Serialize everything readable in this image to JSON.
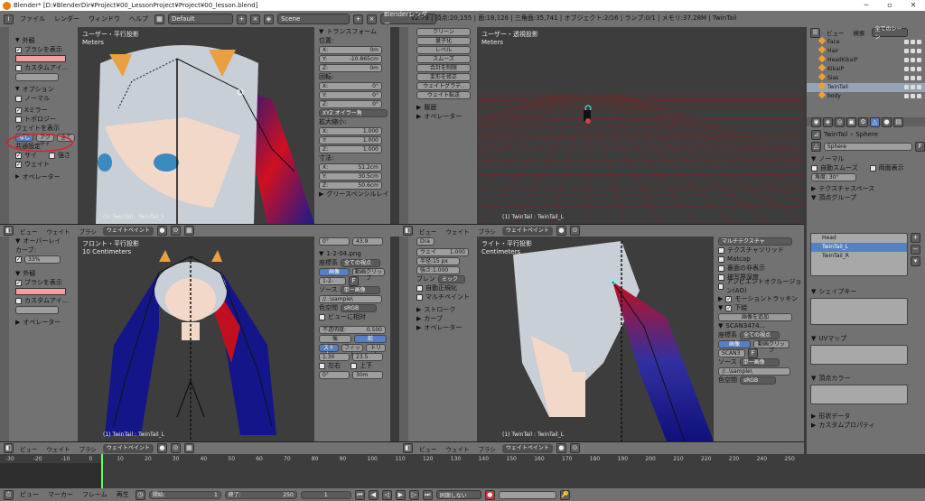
{
  "window": {
    "title": "Blender* [D:¥BlenderDir¥Project¥00_LessonProject¥Project¥00_lesson.blend]"
  },
  "infobar": {
    "menus": [
      "ファイル",
      "レンダー",
      "ウィンドウ",
      "ヘルプ"
    ],
    "layout": "Default",
    "scene": "Scene",
    "engine": "Blenderレンダー",
    "stats": "v2.79 | 頂点:20,155 | 面:18,126 | 三角面:35,741 | オブジェクト:2/16 | ランプ:0/1 | メモリ:37.28M | TwinTail"
  },
  "toolshelf_top": {
    "sections": {
      "display": "外観",
      "show_brush": "ブラシを表示",
      "custom_icon": "カスタムアイ...",
      "options": "オプション",
      "normal": "ノーマル",
      "x_mirror": "Xミラー",
      "topology": "トポロジー",
      "weight_display": "ウェイトを表示",
      "none_active_all": [
        "なし",
        "アクティ",
        "全て"
      ],
      "common": "共通設定",
      "size": "サイ",
      "strength": "強さ",
      "weight": "ウェイト",
      "operator": "オペレーター"
    },
    "tabs": [
      "ツール",
      "グリースペンシル",
      "オプション",
      "スロット"
    ]
  },
  "toolshelf_bottom": {
    "overlay": "オーバーレイ",
    "curve": "カーブ:",
    "curve_val": "33%",
    "display": "外観",
    "show_brush": "ブラシを表示",
    "custom_icon": "カスタムアイ...",
    "operator": "オペレーター"
  },
  "vp_top_left": {
    "label": "ユーザー・平行投影",
    "unit": "Meters",
    "bottom": "(1) TwinTail : TwinTail_L"
  },
  "transform": {
    "title": "トランスフォーム",
    "position": "位置:",
    "pos": [
      [
        "X:",
        "0m"
      ],
      [
        "Y:",
        "-10.865cm"
      ],
      [
        "Z:",
        "0m"
      ]
    ],
    "rotation": "回転:",
    "rot": [
      [
        "X:",
        "0°"
      ],
      [
        "Y:",
        "0°"
      ],
      [
        "Z:",
        "0°"
      ]
    ],
    "rotmode": "XYZ オイラー角",
    "scale": "拡大縮小:",
    "scl": [
      [
        "X:",
        "1.000"
      ],
      [
        "Y:",
        "1.000"
      ],
      [
        "Z:",
        "1.000"
      ]
    ],
    "dims": "寸法:",
    "dim": [
      [
        "X:",
        "51.2cm"
      ],
      [
        "Y:",
        "30.5cm"
      ],
      [
        "Z:",
        "50.6cm"
      ]
    ],
    "gp": "グリースペンシルレイ"
  },
  "weight_tools": {
    "items": [
      "クリーン",
      "量子化",
      "レベル",
      "スムーズ",
      "合計を制限",
      "変形を修正",
      "ウェイトグラデ..",
      "ウェイト転送"
    ],
    "history": "履歴",
    "operator": "オペレーター"
  },
  "vp_top_right": {
    "label": "ユーザー・透視投影",
    "unit": "Meters",
    "bottom": "(1) TwinTail : TwinTail_L"
  },
  "header_row": {
    "view": "ビュー",
    "weight": "ウェイト",
    "brush": "ブラシ",
    "mode": "ウェイトペイント"
  },
  "vp_bot_left": {
    "label": "フロント・平行投影",
    "unit": "10 Centimeters",
    "bottom": "(1) TwinTail : TwinTail_L"
  },
  "texpanel": {
    "angle": "0°",
    "angle2": "43.9",
    "image": "1-2-04.png",
    "coord": "座標系",
    "coord_val": "全ての視点",
    "tab_image": "画像",
    "tab_clip": "動画クリップ",
    "img2": "1-2-",
    "source": "ソース",
    "source_val": "単一画像",
    "path": "//..\\sample\\",
    "color": "色空間",
    "color_val": "sRGB",
    "view_rel": "ビューに相対",
    "opacity": "不透明度:",
    "opacity_val": "0.500",
    "back": "後",
    "front": "前",
    "fit": [
      "ストレ",
      "フィット",
      "トリム"
    ],
    "v1": "1.30",
    "v2": "23.5",
    "lr": "左右",
    "ud": "上下",
    "v3": "0°",
    "v4": "30m"
  },
  "brushpanel": {
    "draw": "Dra",
    "weight": "ウェイ",
    "weight_val": "1.000",
    "radius": "半径:15 px",
    "strength": "強さ:1.000",
    "blend": "ブレン",
    "blend_val": "ミック",
    "auto_norm": "自動正規化",
    "multi": "マルチペイント",
    "stroke": "ストローク",
    "curve": "カーブ",
    "operator": "オペレーター"
  },
  "vp_bot_right": {
    "label": "ライト・平行投影",
    "unit": "Centimeters",
    "bottom": "(1) TwinTail : TwinTail_L"
  },
  "shading": {
    "multitex": "マルチテクスチャ",
    "items": [
      "テクスチャソリッド",
      "Matcap",
      "裏面の非表示",
      "被写界深度",
      "アンビエントオクルージョン(AO)"
    ],
    "motion": "モーショントラッキン",
    "bg": "下絵",
    "add_image": "画像を追加",
    "scan": "SCAN3474...",
    "coord": "座標系",
    "coord_val": "全ての視点",
    "tab_image": "画像",
    "tab_clip": "動画クリップ",
    "scan2": "SCAN3",
    "source": "ソース",
    "source_val": "単一画像",
    "path": "//..\\sample\\",
    "color": "色空間",
    "color_val": "sRGB"
  },
  "outliner": {
    "view": "ビュー",
    "search": "検索",
    "scene": "全てのシーン",
    "items": [
      "Face",
      "Hair",
      "HeadKikaiP",
      "KikaiP",
      "Sias",
      "TwinTail",
      "body"
    ]
  },
  "props": {
    "breadcrumb": [
      "TwinTail",
      "Sphere"
    ],
    "mesh_name": "Sphere",
    "normal": "ノーマル",
    "auto_smooth": "自動スムーズ",
    "double_sided": "両面表示",
    "angle": "角度: 30°",
    "tex_space": "テクスチャスペース",
    "vgroups": "頂点グループ",
    "groups": [
      "Head",
      "TwinTail_L",
      "TwinTail_R"
    ],
    "shapekeys": "シェイプキー",
    "uv": "UVマップ",
    "vcolor": "頂点カラー",
    "geom": "形状データ",
    "custom": "カスタムプロパティ"
  },
  "timeline": {
    "ticks": [
      "-30",
      "-20",
      "-10",
      "0",
      "10",
      "20",
      "30",
      "40",
      "50",
      "60",
      "70",
      "80",
      "90",
      "100",
      "110",
      "120",
      "130",
      "140",
      "150",
      "160",
      "170",
      "180",
      "190",
      "200",
      "210",
      "220",
      "230",
      "240",
      "250"
    ],
    "menus": [
      "ビュー",
      "マーカー",
      "フレーム",
      "再生"
    ],
    "start": "開始:",
    "start_val": "1",
    "end": "終了:",
    "end_val": "250",
    "current": "1",
    "sync": "同期しない"
  }
}
